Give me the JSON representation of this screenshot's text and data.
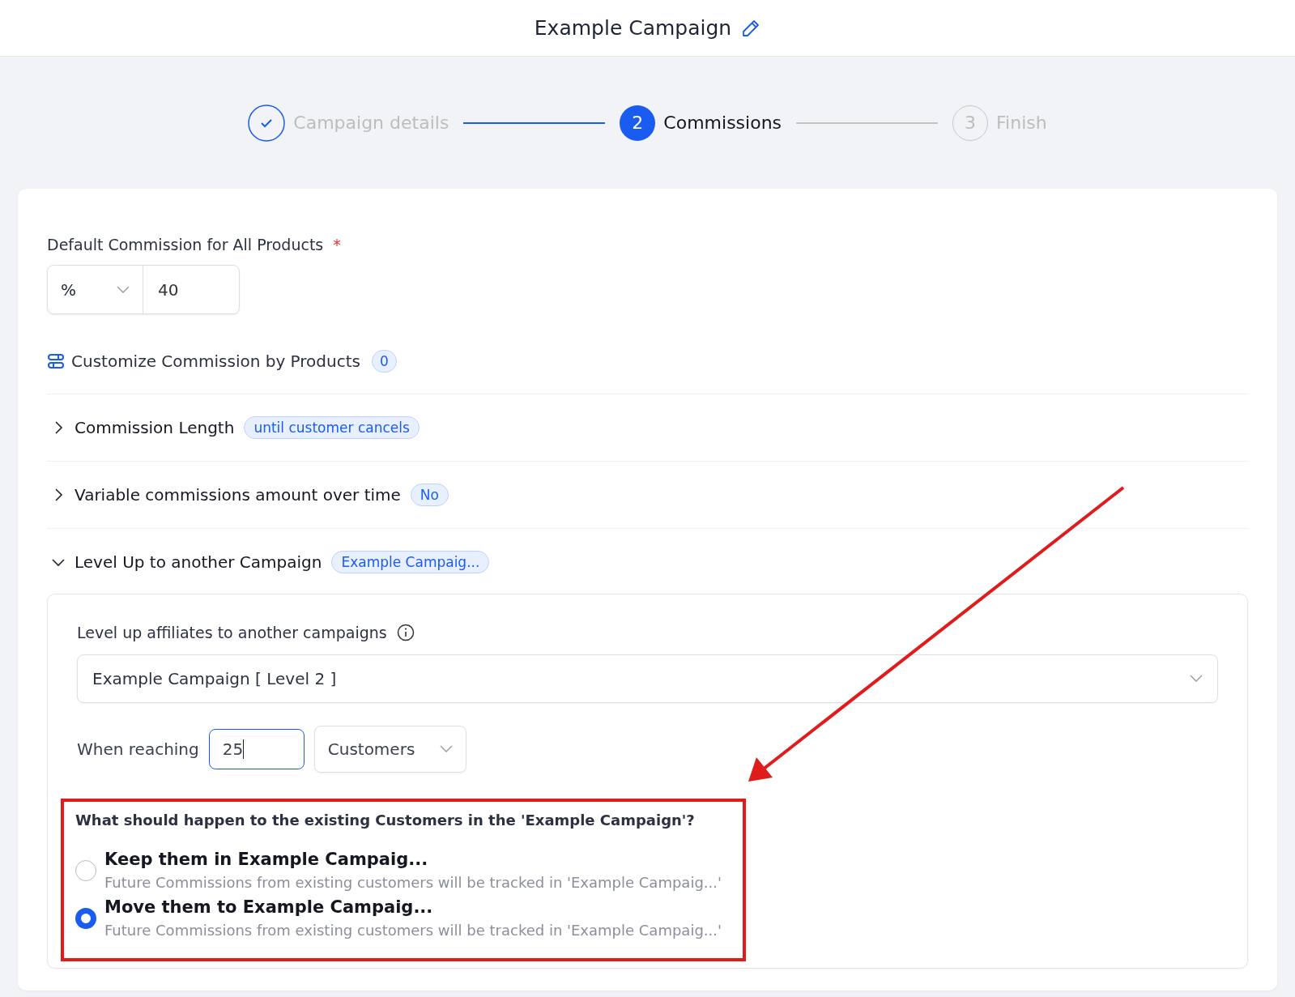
{
  "header": {
    "title": "Example Campaign"
  },
  "steps": [
    {
      "label": "Campaign details",
      "completed": true,
      "selected": false
    },
    {
      "number": "2",
      "label": "Commissions",
      "completed": false,
      "selected": true
    },
    {
      "number": "3",
      "label": "Finish",
      "completed": false,
      "selected": false
    }
  ],
  "default_commission": {
    "label": "Default Commission for All Products",
    "required_mark": "*",
    "type_select": "%",
    "value": "40"
  },
  "customize": {
    "label": "Customize Commission by Products",
    "count": "0"
  },
  "sections": [
    {
      "title": "Commission Length",
      "badge": "until customer cancels",
      "expanded": false
    },
    {
      "title": "Variable commissions amount over time",
      "badge": "No",
      "expanded": false
    },
    {
      "title": "Level Up to another Campaign",
      "badge": "Example Campaig...",
      "expanded": true
    }
  ],
  "level_up": {
    "label": "Level up affiliates to another campaigns",
    "campaign_select": "Example Campaign [ Level 2 ]",
    "when_label": "When reaching",
    "threshold": "25",
    "unit_select": "Customers",
    "question": "What should happen to the existing Customers in the 'Example Campaign'?",
    "options": [
      {
        "title": "Keep them in Example Campaig...",
        "description": "Future Commissions from existing customers will be tracked in 'Example Campaig...'",
        "selected": false
      },
      {
        "title": "Move them to Example Campaig...",
        "description": "Future Commissions from existing customers will be tracked in 'Example Campaig...'",
        "selected": true
      }
    ]
  }
}
